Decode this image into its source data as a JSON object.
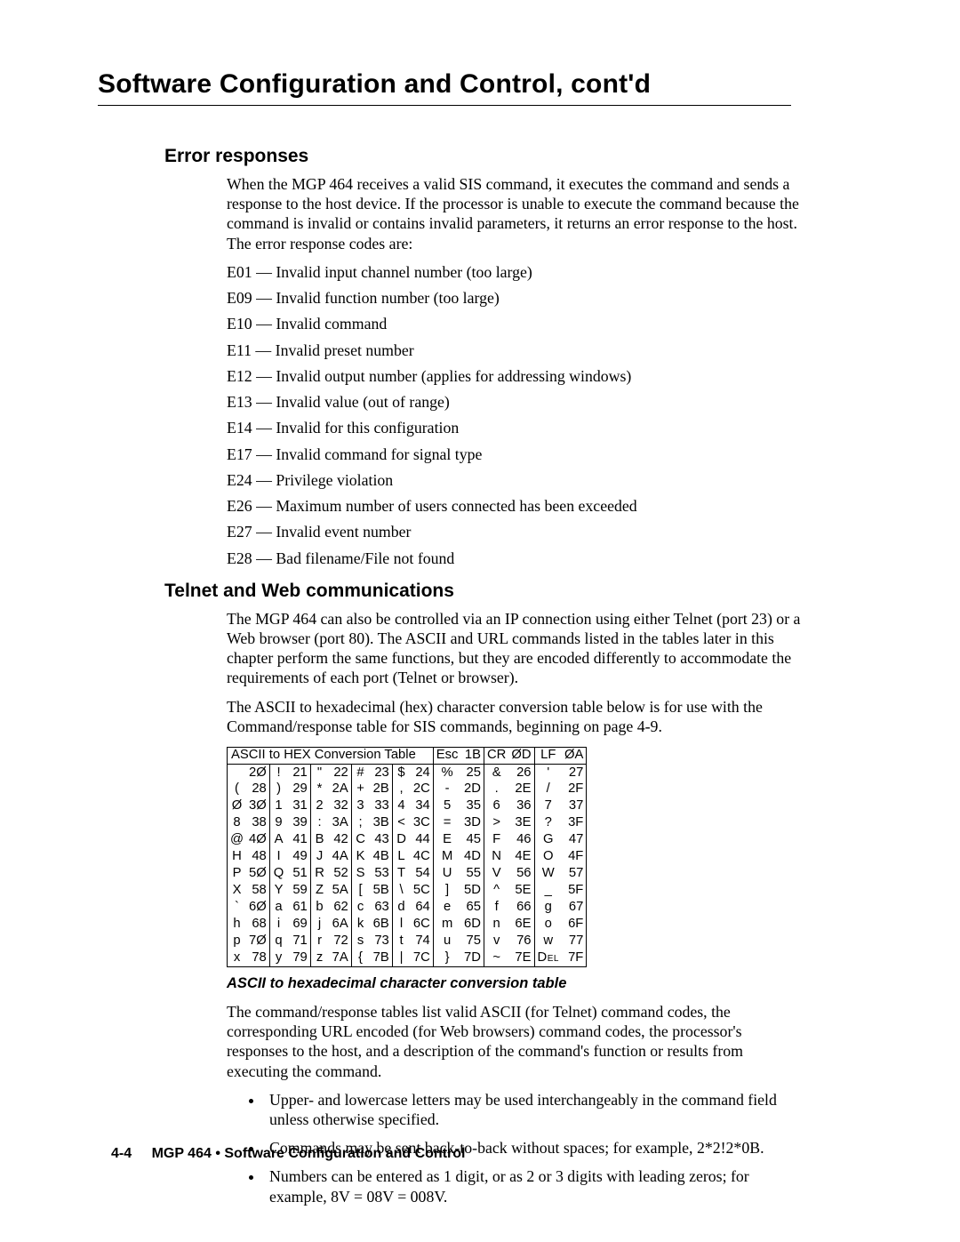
{
  "chapter_title": "Software Configuration and Control, cont'd",
  "sections": {
    "error": {
      "heading": "Error responses",
      "intro": "When the MGP 464 receives a valid SIS command, it executes the command and sends a response to the host device.  If the processor is unable to execute the command because the command is invalid or contains invalid parameters, it returns an error response to the host.  The error response codes are:",
      "codes": [
        "E01 — Invalid input channel number (too large)",
        "E09 — Invalid function number (too large)",
        "E10 — Invalid command",
        "E11 — Invalid preset number",
        "E12 — Invalid output number (applies for addressing windows)",
        "E13 — Invalid value (out of range)",
        "E14 — Invalid for this configuration",
        "E17 — Invalid command for signal type",
        "E24 — Privilege violation",
        "E26 — Maximum number of users connected has been exceeded",
        "E27 — Invalid event number",
        "E28 — Bad filename/File not found"
      ]
    },
    "telnet": {
      "heading": "Telnet and Web communications",
      "p1": "The MGP 464 can also be controlled via an IP connection using either Telnet (port 23) or a Web browser (port 80).  The ASCII and URL commands listed in the tables later in this chapter perform the same functions, but they are encoded differently to accommodate the requirements of each port (Telnet or browser).",
      "p2": "The ASCII to hexadecimal (hex) character conversion table below is for use with the Command/response table for SIS commands, beginning on page 4-9.",
      "caption": "ASCII to hexadecimal character conversion table",
      "p3": "The command/response tables list valid ASCII (for Telnet) command codes, the corresponding URL encoded (for Web browsers) command codes, the processor's responses to the host, and a description of the command's function or results from executing the command.",
      "bullets": [
        "Upper- and lowercase letters may be used interchangeably in the command field unless otherwise specified.",
        "Commands may be sent back-to-back without spaces; for example, 2*2!2*0B.",
        "Numbers can be entered as 1 digit, or as 2 or 3 digits with leading zeros; for example, 8V = 08V = 008V."
      ]
    }
  },
  "chart_data": {
    "type": "table",
    "title": "ASCII to HEX  Conversion Table",
    "header_extra": [
      {
        "label": "Esc",
        "hex": "1B"
      },
      {
        "label": "CR",
        "hex": "0D"
      },
      {
        "label": "LF",
        "hex": "0A"
      }
    ],
    "rows": [
      [
        [
          " ",
          "20"
        ],
        [
          "!",
          "21"
        ],
        [
          "\"",
          "22"
        ],
        [
          "#",
          "23"
        ],
        [
          "$",
          "24"
        ],
        [
          "%",
          "25"
        ],
        [
          "&",
          "26"
        ],
        [
          "'",
          "27"
        ]
      ],
      [
        [
          "(",
          "28"
        ],
        [
          ")",
          "29"
        ],
        [
          "*",
          "2A"
        ],
        [
          "+",
          "2B"
        ],
        [
          ",",
          "2C"
        ],
        [
          "-",
          "2D"
        ],
        [
          ".",
          "2E"
        ],
        [
          "/",
          "2F"
        ]
      ],
      [
        [
          "0",
          "30"
        ],
        [
          "1",
          "31"
        ],
        [
          "2",
          "32"
        ],
        [
          "3",
          "33"
        ],
        [
          "4",
          "34"
        ],
        [
          "5",
          "35"
        ],
        [
          "6",
          "36"
        ],
        [
          "7",
          "37"
        ]
      ],
      [
        [
          "8",
          "38"
        ],
        [
          "9",
          "39"
        ],
        [
          ":",
          "3A"
        ],
        [
          ";",
          "3B"
        ],
        [
          "<",
          "3C"
        ],
        [
          "=",
          "3D"
        ],
        [
          ">",
          "3E"
        ],
        [
          "?",
          "3F"
        ]
      ],
      [
        [
          "@",
          "40"
        ],
        [
          "A",
          "41"
        ],
        [
          "B",
          "42"
        ],
        [
          "C",
          "43"
        ],
        [
          "D",
          "44"
        ],
        [
          "E",
          "45"
        ],
        [
          "F",
          "46"
        ],
        [
          "G",
          "47"
        ]
      ],
      [
        [
          "H",
          "48"
        ],
        [
          "I",
          "49"
        ],
        [
          "J",
          "4A"
        ],
        [
          "K",
          "4B"
        ],
        [
          "L",
          "4C"
        ],
        [
          "M",
          "4D"
        ],
        [
          "N",
          "4E"
        ],
        [
          "O",
          "4F"
        ]
      ],
      [
        [
          "P",
          "50"
        ],
        [
          "Q",
          "51"
        ],
        [
          "R",
          "52"
        ],
        [
          "S",
          "53"
        ],
        [
          "T",
          "54"
        ],
        [
          "U",
          "55"
        ],
        [
          "V",
          "56"
        ],
        [
          "W",
          "57"
        ]
      ],
      [
        [
          "X",
          "58"
        ],
        [
          "Y",
          "59"
        ],
        [
          "Z",
          "5A"
        ],
        [
          "[",
          "5B"
        ],
        [
          "\\",
          "5C"
        ],
        [
          "]",
          "5D"
        ],
        [
          "^",
          "5E"
        ],
        [
          "_",
          "5F"
        ]
      ],
      [
        [
          "`",
          "60"
        ],
        [
          "a",
          "61"
        ],
        [
          "b",
          "62"
        ],
        [
          "c",
          "63"
        ],
        [
          "d",
          "64"
        ],
        [
          "e",
          "65"
        ],
        [
          "f",
          "66"
        ],
        [
          "g",
          "67"
        ]
      ],
      [
        [
          "h",
          "68"
        ],
        [
          "i",
          "69"
        ],
        [
          "j",
          "6A"
        ],
        [
          "k",
          "6B"
        ],
        [
          "l",
          "6C"
        ],
        [
          "m",
          "6D"
        ],
        [
          "n",
          "6E"
        ],
        [
          "o",
          "6F"
        ]
      ],
      [
        [
          "p",
          "70"
        ],
        [
          "q",
          "71"
        ],
        [
          "r",
          "72"
        ],
        [
          "s",
          "73"
        ],
        [
          "t",
          "74"
        ],
        [
          "u",
          "75"
        ],
        [
          "v",
          "76"
        ],
        [
          "w",
          "77"
        ]
      ],
      [
        [
          "x",
          "78"
        ],
        [
          "y",
          "79"
        ],
        [
          "z",
          "7A"
        ],
        [
          "{",
          "7B"
        ],
        [
          "|",
          "7C"
        ],
        [
          "}",
          "7D"
        ],
        [
          "~",
          "7E"
        ],
        [
          "Del",
          "7F"
        ]
      ]
    ],
    "slashed_zero_note": "Digits 0 in table header and in 0-prefixed glyphs are rendered with a slashed zero in the source image."
  },
  "footer": {
    "page_number": "4-4",
    "text": "MGP 464 • Software Configuration and Control"
  }
}
